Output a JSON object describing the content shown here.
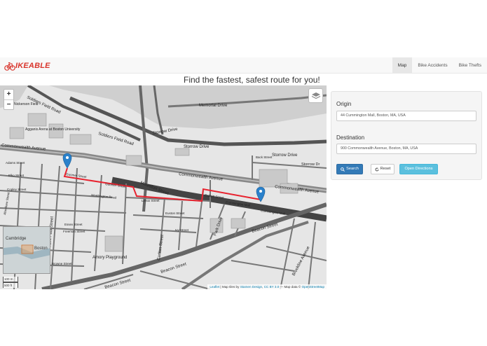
{
  "brand": {
    "text": "IKEABLE"
  },
  "nav": {
    "items": [
      {
        "label": "Map",
        "active": true
      },
      {
        "label": "Bike Accidents",
        "active": false
      },
      {
        "label": "Bike Thefts",
        "active": false
      }
    ]
  },
  "headline": "Find the fastest, safest route for you!",
  "map": {
    "zoom_in": "+",
    "zoom_out": "−",
    "street_labels": {
      "soldiers_field_road_1": "Soldiers Field Road",
      "soldiers_field_road_2": "Soldiers Field Road",
      "storrow_drive_1": "Storrow Drive",
      "storrow_drive_2": "Storrow Drive",
      "storrow_drive_3": "Storrow Drive",
      "storrow_dr": "Storrow Dr",
      "memorial_drive": "Memorial Drive",
      "commonwealth_avenue_1": "Commonwealth Avenue",
      "commonwealth_avenue_2": "Commonwealth Avenue",
      "commonwealth_avenue_3": "Commonwealth Avenue",
      "mountfort_street": "Mountfort Street",
      "gunmer_street_1": "Gunmer Street",
      "gunmer_street_2": "Gunmer Street",
      "worthington_road": "Worthington Road",
      "babbitt_street": "Babbitt Street",
      "cummington_mall_1": "Cummington Mall",
      "cummington_mall_2": "Cummington Mall",
      "back_street": "Back Street",
      "beacon_street_1": "Beacon Street",
      "beacon_street_2": "Beacon Street",
      "beacon_street_3": "Beacon Street",
      "saint_paul_street": "Saint Paul Street",
      "carlton_street": "Carlton Street",
      "amory_playground": "Amory Playground",
      "agganis_arena": "Agganis Arena at Boston University",
      "nickerson_field": "Nickerson Field",
      "adams_street": "Adams Street",
      "elko_street": "Elko Street",
      "copley_street": "Copley Street",
      "aberdeen_street": "Aberdeen Street",
      "lenox_street": "Lenox Street",
      "euston_street": "Euston Street",
      "ivy_street": "Ivy Street",
      "park_drive": "Park Drive",
      "essex_street": "Essex Street",
      "freeman_street": "Freeman Street",
      "browne_street": "Browne Street",
      "brookline_avenue": "Brookline Avenue"
    },
    "minimap": {
      "label_1": "Cambridge",
      "label_2": "Boston"
    },
    "scale": {
      "metric": "100 m",
      "imperial": "500 ft"
    },
    "attribution": {
      "leaflet": "Leaflet",
      "text_1": " | Map tiles by ",
      "stamen": "Stamen Design",
      "text_2": ", ",
      "cc": "CC BY 3.0",
      "text_3": " — Map data © ",
      "osm": "OpenStreetMap"
    },
    "route_color": "#e8232f",
    "marker_color": "#2a81cb"
  },
  "form": {
    "origin_label": "Origin",
    "origin_value": "44 Cummington Mall, Boston, MA, USA",
    "destination_label": "Destination",
    "destination_value": "900 Commonwealth Avenue, Boston, MA, USA",
    "search_button": "Search",
    "reset_button": "Reset",
    "directions_button": "Open Directions"
  }
}
